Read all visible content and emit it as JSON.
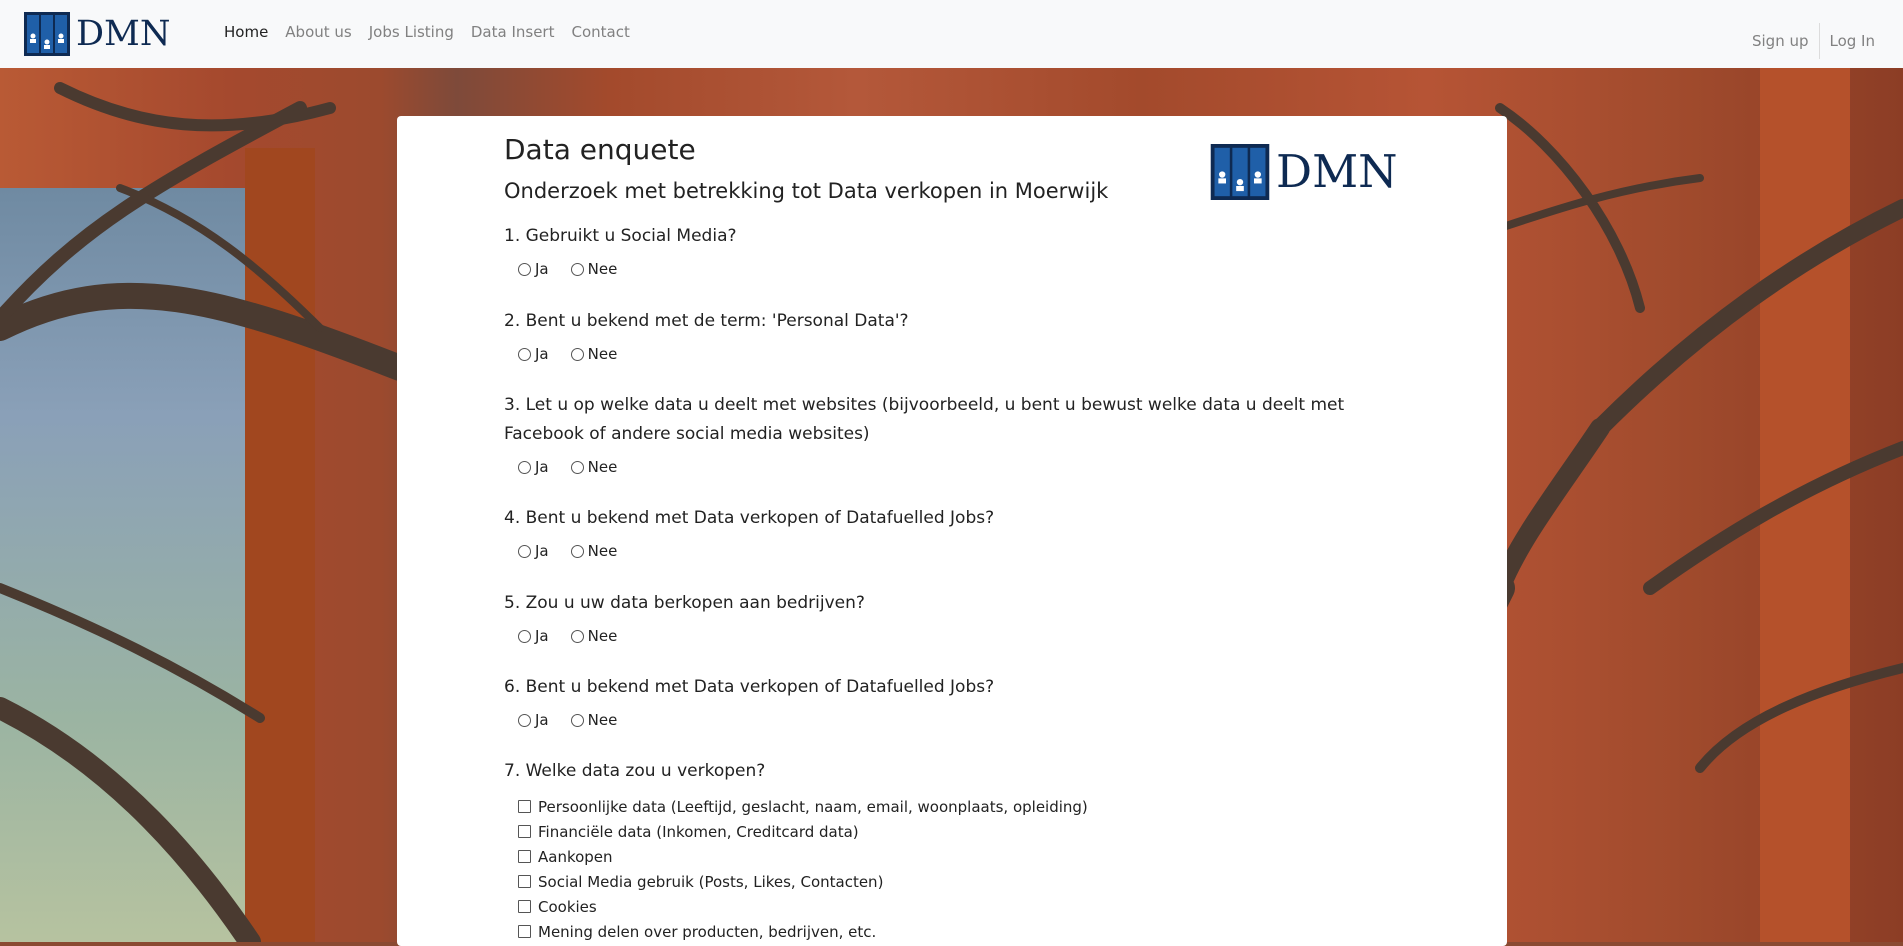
{
  "brand": {
    "name": "DMN"
  },
  "nav": {
    "links": [
      {
        "label": "Home",
        "active": true
      },
      {
        "label": "About us"
      },
      {
        "label": "Jobs Listing"
      },
      {
        "label": "Data Insert"
      },
      {
        "label": "Contact"
      }
    ],
    "right": [
      {
        "label": "Sign up"
      },
      {
        "label": "Log In"
      }
    ]
  },
  "colors": {
    "brand_navy": "#0e2a52",
    "brand_blue": "#1f5fa8",
    "navbar_bg": "#f8f9fa"
  },
  "survey": {
    "title": "Data enquete",
    "subtitle": "Onderzoek met betrekking tot Data verkopen in Moerwijk",
    "questions": [
      {
        "text": "1. Gebruikt u Social Media?",
        "options": [
          "Ja",
          "Nee"
        ]
      },
      {
        "text": "2. Bent u bekend met de term: 'Personal Data'?",
        "options": [
          "Ja",
          "Nee"
        ]
      },
      {
        "text": "3. Let u op welke data u deelt met websites (bijvoorbeeld, u bent u bewust welke data u deelt met Facebook of andere social media websites)",
        "options": [
          "Ja",
          "Nee"
        ]
      },
      {
        "text": "4. Bent u bekend met Data verkopen of Datafuelled Jobs?",
        "options": [
          "Ja",
          "Nee"
        ]
      },
      {
        "text": "5. Zou u uw data berkopen aan bedrijven?",
        "options": [
          "Ja",
          "Nee"
        ]
      },
      {
        "text": "6. Bent u bekend met Data verkopen of Datafuelled Jobs?",
        "options": [
          "Ja",
          "Nee"
        ]
      },
      {
        "text": "7. Welke data zou u verkopen?"
      }
    ],
    "checkboxes": [
      "Persoonlijke data (Leeftijd, geslacht, naam, email, woonplaats, opleiding)",
      "Financiële data (Inkomen, Creditcard data)",
      "Aankopen",
      "Social Media gebruik (Posts, Likes, Contacten)",
      "Cookies",
      "Mening delen over producten, bedrijven, etc."
    ]
  }
}
